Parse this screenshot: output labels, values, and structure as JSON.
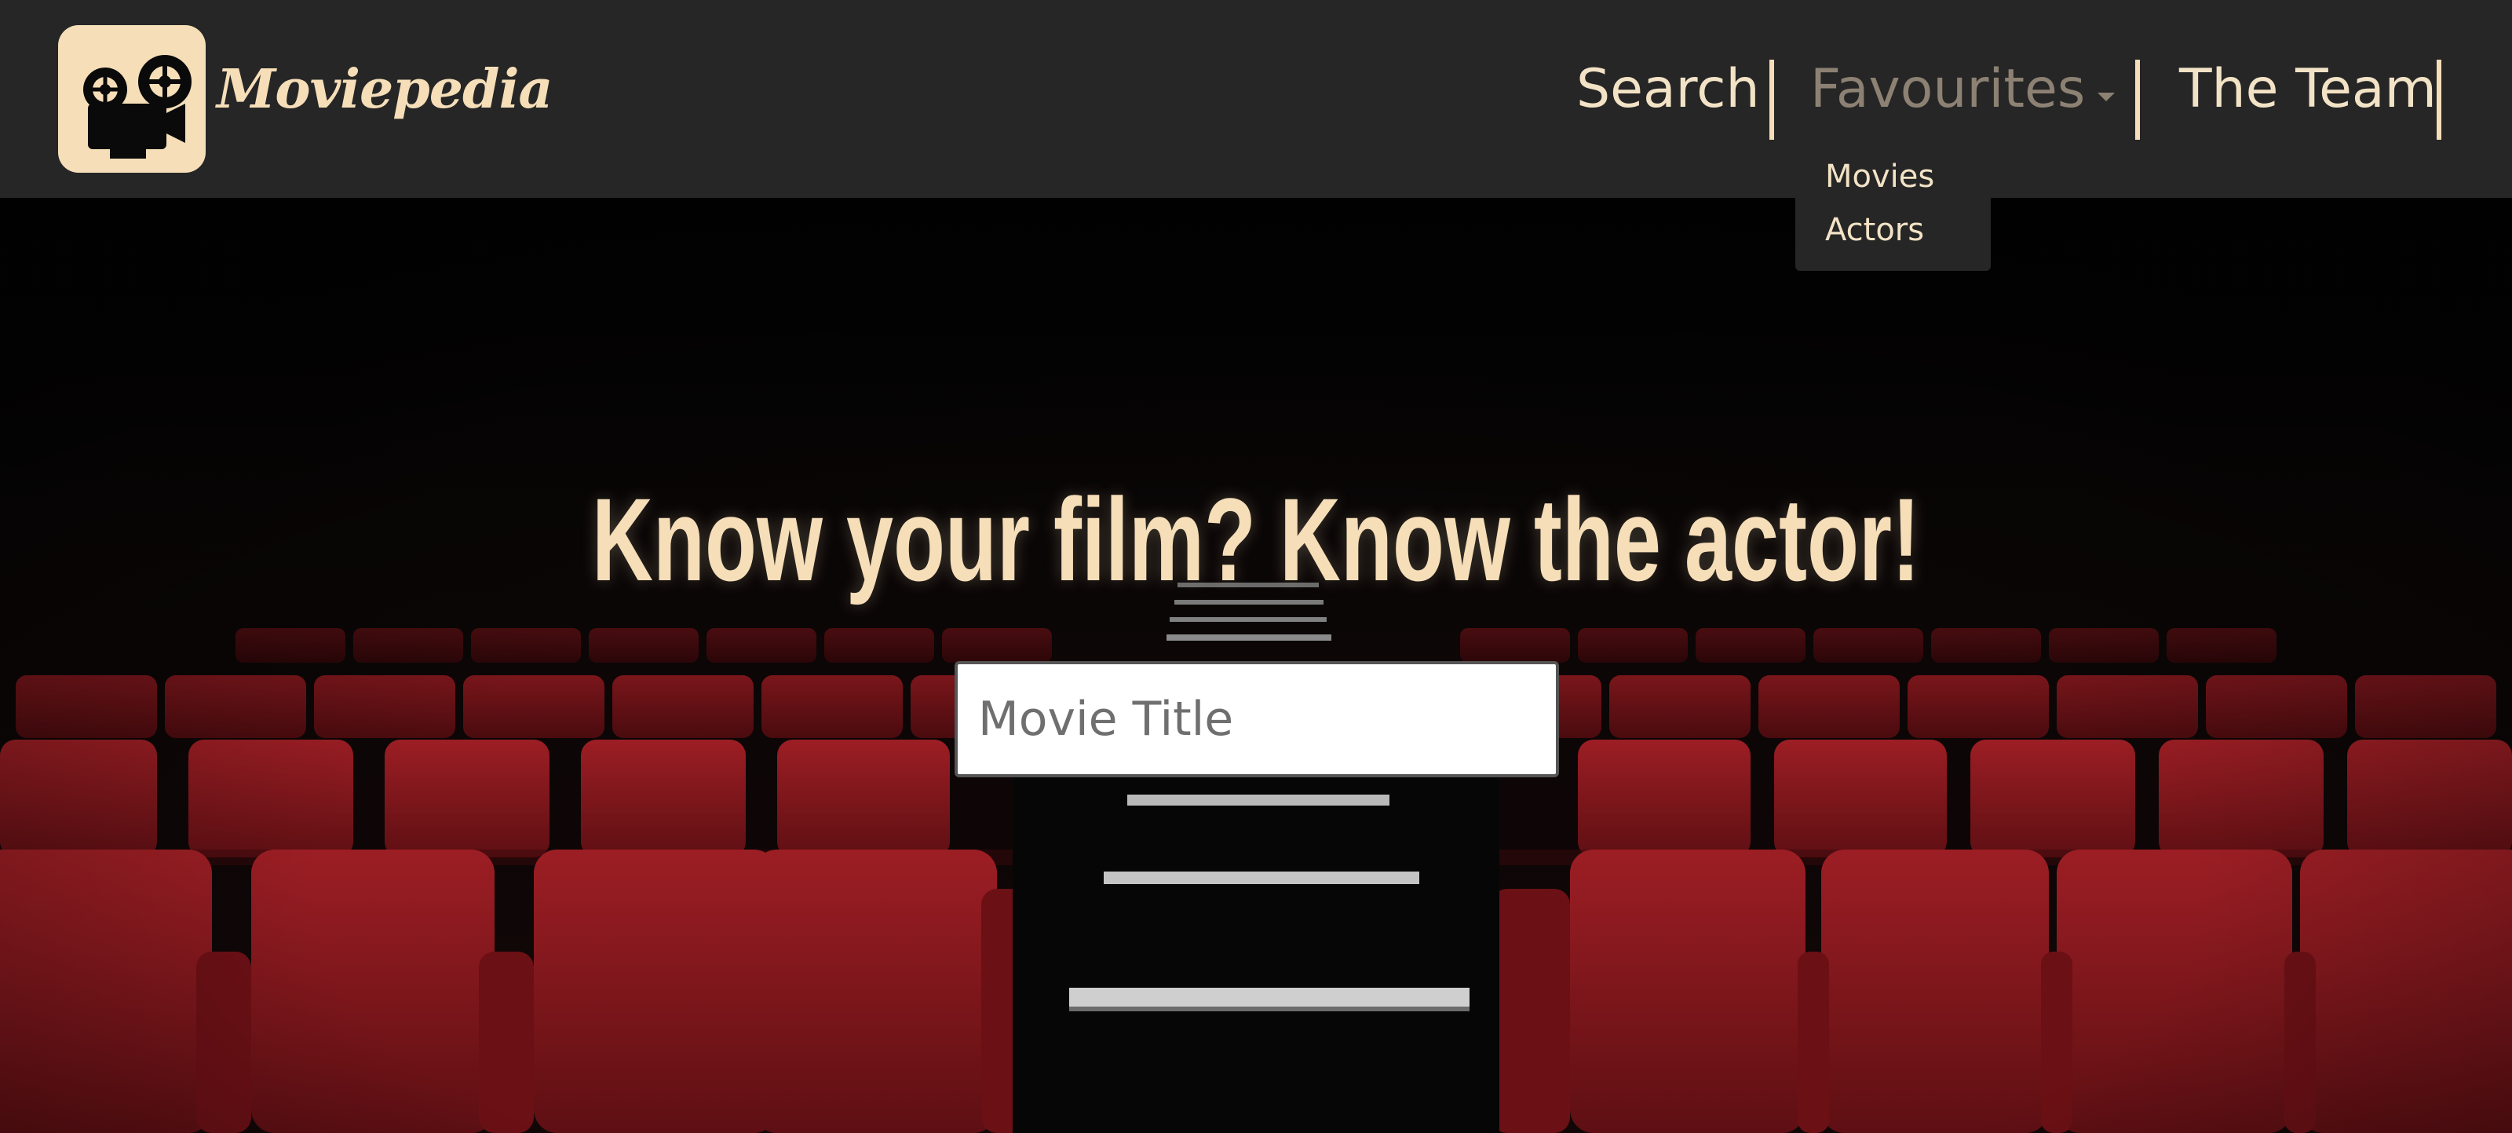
{
  "brand": {
    "name": "Moviepedia",
    "logo_icon": "film-projector-icon"
  },
  "nav": {
    "search_label": "Search",
    "favourites_label": "Favourites",
    "team_label": "The Team",
    "favourites_menu": [
      "Movies",
      "Actors"
    ]
  },
  "hero": {
    "headline": "Know your film? Know the actor!",
    "background": "cinema-seats-image"
  },
  "search": {
    "placeholder": "Movie Title",
    "value": ""
  },
  "colors": {
    "navbar": "#262626",
    "accent": "#f5deb8",
    "muted_link": "#8c8173",
    "seat_red": "#8b1a1f"
  }
}
